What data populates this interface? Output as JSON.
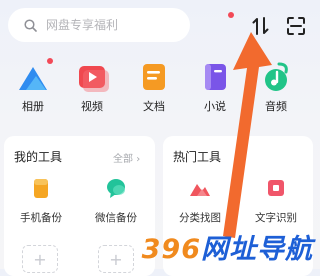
{
  "search": {
    "placeholder": "网盘专享福利",
    "icon": "search-icon"
  },
  "header": {
    "transfer_icon": "transfer-arrows-icon",
    "scan_icon": "scan-icon",
    "notification_color": "#f24957"
  },
  "apps": [
    {
      "label": "相册",
      "icon": "photo-mountain-icon",
      "color": "#2f8cf0"
    },
    {
      "label": "视频",
      "icon": "video-play-icon",
      "color": "#f0484f"
    },
    {
      "label": "文档",
      "icon": "document-icon",
      "color": "#f59a23"
    },
    {
      "label": "小说",
      "icon": "book-icon",
      "color": "#7a55e8"
    },
    {
      "label": "音频",
      "icon": "music-note-icon",
      "color": "#21c488"
    }
  ],
  "my_tools": {
    "title": "我的工具",
    "more": "全部",
    "items": [
      {
        "label": "手机备份",
        "icon": "phone-backup-icon",
        "color": "#f5a623"
      },
      {
        "label": "微信备份",
        "icon": "wechat-backup-icon",
        "color": "#22c39a"
      }
    ]
  },
  "hot_tools": {
    "title": "热门工具",
    "items": [
      {
        "label": "分类找图",
        "icon": "image-search-icon",
        "color": "#f0565e"
      },
      {
        "label": "文字识别",
        "icon": "text-recognition-icon",
        "color": "#f0566a"
      }
    ]
  },
  "watermark": {
    "number": "396",
    "text": "网址导航"
  },
  "arrow_color": "#f26a2e"
}
